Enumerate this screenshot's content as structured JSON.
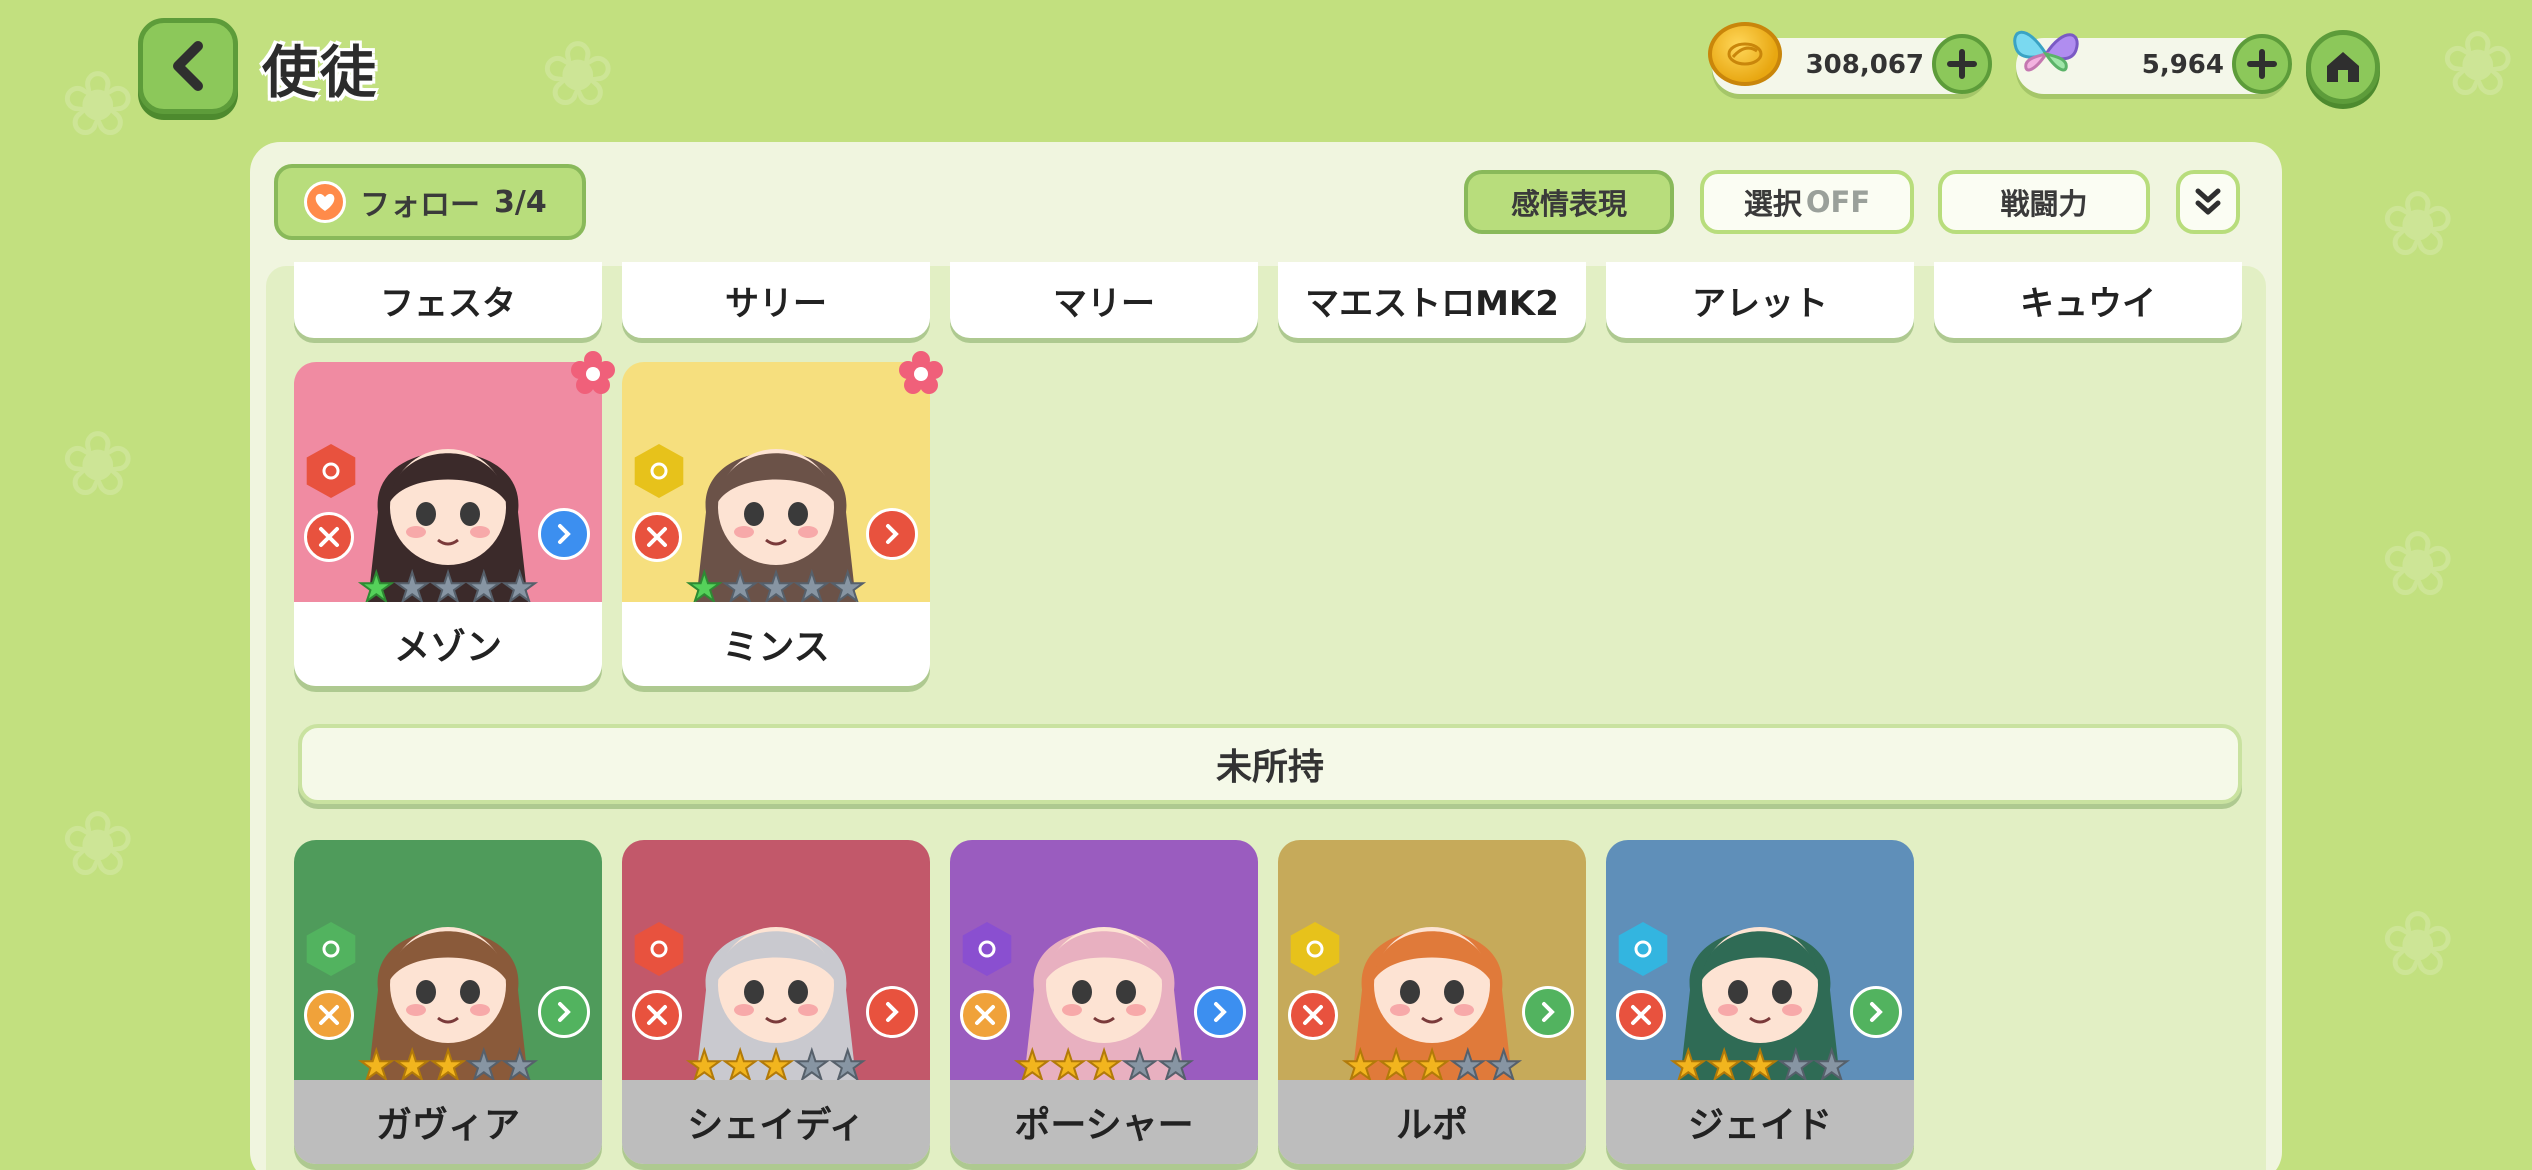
{
  "header": {
    "title": "使徒",
    "coins": "308,067",
    "gems": "5,964"
  },
  "toolbar": {
    "follow_label": "フォロー",
    "follow_count": "3/4",
    "emotion_label": "感情表現",
    "select_label": "選択",
    "select_state": "OFF",
    "power_label": "戦闘力"
  },
  "name_row": [
    "フェスタ",
    "サリー",
    "マリー",
    "マエストロMK2",
    "アレット",
    "キュウイ"
  ],
  "owned": [
    {
      "name": "メゾン",
      "stars": 1,
      "bg": "#f08ba2",
      "elem_color": "#e8523e",
      "role_color": "#e8523e",
      "class_color": "#3c8ff0"
    },
    {
      "name": "ミンス",
      "stars": 1,
      "bg": "#f6df7e",
      "elem_color": "#e7c21b",
      "role_color": "#e8523e",
      "class_color": "#e8523e"
    }
  ],
  "unowned_section": "未所持",
  "unowned": [
    {
      "name": "ガヴィア",
      "stars": 3,
      "bg": "#4f9b5b",
      "elem_color": "#52b35f",
      "role_color": "#f0a23a",
      "class_color": "#52b35f"
    },
    {
      "name": "シェイディ",
      "stars": 3,
      "bg": "#c2586a",
      "elem_color": "#e8523e",
      "role_color": "#e8523e",
      "class_color": "#e8523e"
    },
    {
      "name": "ポーシャー",
      "stars": 3,
      "bg": "#9a5cbf",
      "elem_color": "#8a4fd0",
      "role_color": "#f0a23a",
      "class_color": "#3c8ff0"
    },
    {
      "name": "ルポ",
      "stars": 3,
      "bg": "#c6aa5a",
      "elem_color": "#e7c21b",
      "role_color": "#e8523e",
      "class_color": "#52b35f"
    },
    {
      "name": "ジェイド",
      "stars": 3,
      "bg": "#5f8fb9",
      "elem_color": "#33b5e0",
      "role_color": "#e8523e",
      "class_color": "#52b35f"
    }
  ]
}
